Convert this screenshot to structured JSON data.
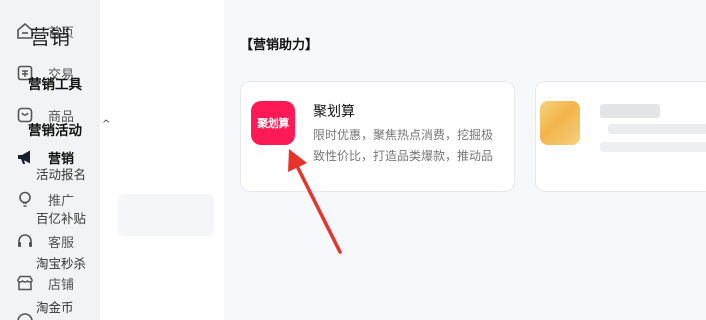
{
  "nav": {
    "items": [
      {
        "label": "首页",
        "icon": "home-icon"
      },
      {
        "label": "交易",
        "icon": "orders-icon"
      },
      {
        "label": "商品",
        "icon": "bag-icon"
      },
      {
        "label": "营销",
        "icon": "megaphone-icon",
        "active": true
      },
      {
        "label": "推广",
        "icon": "bulb-icon"
      },
      {
        "label": "客服",
        "icon": "headset-icon"
      },
      {
        "label": "店铺",
        "icon": "store-icon"
      }
    ]
  },
  "submenu": {
    "title": "营销",
    "tools_label": "营销工具",
    "activities_label": "营销活动",
    "caret": "^",
    "items": [
      "活动报名",
      "百亿补贴",
      "淘宝秒杀",
      "淘金币"
    ]
  },
  "main": {
    "section_title": "【营销助力】",
    "cards": [
      {
        "logo_text": "聚划算",
        "name": "聚划算",
        "desc_line1": "限时优惠，聚焦热点消费，挖掘极",
        "desc_line2": "致性价比，打造品类爆款，推动品"
      }
    ]
  },
  "colors": {
    "brand_red": "#ff1a55",
    "arrow_red": "#e8332c",
    "nav_bg": "#f1f3f7"
  }
}
